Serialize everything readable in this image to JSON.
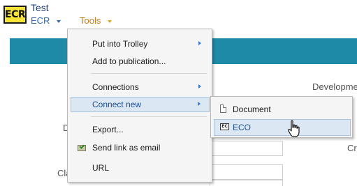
{
  "header": {
    "logo_text": "ECR",
    "title": "Test",
    "menu_ecr": "ECR",
    "menu_tools": "Tools"
  },
  "background_labels": {
    "right_top": "Developme",
    "left_mid": "D",
    "right_mid": "Cr",
    "left_low": "Cla"
  },
  "tools_menu": {
    "items": [
      {
        "label": "Put into Trolley",
        "submenu": true
      },
      {
        "label": "Add to publication...",
        "submenu": false
      },
      {
        "label": "Connections",
        "submenu": true
      },
      {
        "label": "Connect new",
        "submenu": true,
        "highlighted": true
      },
      {
        "label": "Export...",
        "submenu": false
      },
      {
        "label": "Send link as email",
        "submenu": false,
        "icon": "email-check-icon"
      },
      {
        "label": "URL",
        "submenu": false
      }
    ]
  },
  "connect_new_submenu": {
    "items": [
      {
        "label": "Document",
        "icon": "document-icon"
      },
      {
        "label": "ECO",
        "icon": "eco-icon",
        "icon_text": "EC",
        "highlighted": true
      }
    ]
  },
  "colors": {
    "teal_band": "#1e8aa8",
    "logo_bg": "#f4e43a",
    "menu_ecr": "#2f6db5",
    "menu_tools": "#c97a1a",
    "highlight_bg": "#dbe7f3"
  }
}
